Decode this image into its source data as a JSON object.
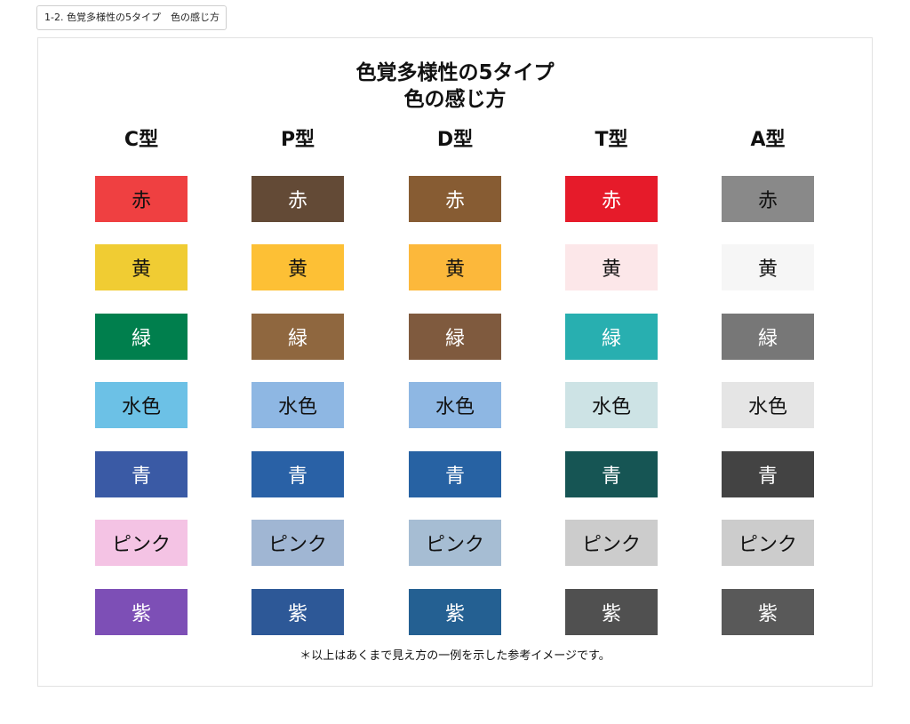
{
  "tab": {
    "label": "1-2. 色覚多様性の5タイプ　色の感じ方"
  },
  "title": {
    "line1": "色覚多様性の5タイプ",
    "line2": "色の感じ方"
  },
  "columns": [
    {
      "name": "C型",
      "swatches": [
        {
          "label": "赤",
          "bg": "#EF4041",
          "fg": "#111111"
        },
        {
          "label": "黄",
          "bg": "#F0CC33",
          "fg": "#111111"
        },
        {
          "label": "緑",
          "bg": "#007F4D",
          "fg": "#FFFFFF"
        },
        {
          "label": "水色",
          "bg": "#6CC1E6",
          "fg": "#111111"
        },
        {
          "label": "青",
          "bg": "#3A5AA5",
          "fg": "#FFFFFF"
        },
        {
          "label": "ピンク",
          "bg": "#F4C3E4",
          "fg": "#111111"
        },
        {
          "label": "紫",
          "bg": "#7D4FB6",
          "fg": "#FFFFFF"
        }
      ]
    },
    {
      "name": "P型",
      "swatches": [
        {
          "label": "赤",
          "bg": "#634A36",
          "fg": "#FFFFFF"
        },
        {
          "label": "黄",
          "bg": "#FDC035",
          "fg": "#111111"
        },
        {
          "label": "緑",
          "bg": "#8F673F",
          "fg": "#FFFFFF"
        },
        {
          "label": "水色",
          "bg": "#8EB7E3",
          "fg": "#111111"
        },
        {
          "label": "青",
          "bg": "#2961A6",
          "fg": "#FFFFFF"
        },
        {
          "label": "ピンク",
          "bg": "#A0B6D3",
          "fg": "#111111"
        },
        {
          "label": "紫",
          "bg": "#2D5897",
          "fg": "#FFFFFF"
        }
      ]
    },
    {
      "name": "D型",
      "swatches": [
        {
          "label": "赤",
          "bg": "#875C33",
          "fg": "#FFFFFF"
        },
        {
          "label": "黄",
          "bg": "#FCB83B",
          "fg": "#111111"
        },
        {
          "label": "緑",
          "bg": "#7F5A3E",
          "fg": "#FFFFFF"
        },
        {
          "label": "水色",
          "bg": "#8EB7E3",
          "fg": "#111111"
        },
        {
          "label": "青",
          "bg": "#2762A3",
          "fg": "#FFFFFF"
        },
        {
          "label": "ピンク",
          "bg": "#A6BDD3",
          "fg": "#111111"
        },
        {
          "label": "紫",
          "bg": "#246092",
          "fg": "#FFFFFF"
        }
      ]
    },
    {
      "name": "T型",
      "swatches": [
        {
          "label": "赤",
          "bg": "#E61B2A",
          "fg": "#FFFFFF"
        },
        {
          "label": "黄",
          "bg": "#FCE7E9",
          "fg": "#111111"
        },
        {
          "label": "緑",
          "bg": "#28AFB0",
          "fg": "#FFFFFF"
        },
        {
          "label": "水色",
          "bg": "#CDE3E5",
          "fg": "#111111"
        },
        {
          "label": "青",
          "bg": "#165554",
          "fg": "#FFFFFF"
        },
        {
          "label": "ピンク",
          "bg": "#CCCCCC",
          "fg": "#111111"
        },
        {
          "label": "紫",
          "bg": "#505050",
          "fg": "#FFFFFF"
        }
      ]
    },
    {
      "name": "A型",
      "swatches": [
        {
          "label": "赤",
          "bg": "#898989",
          "fg": "#111111"
        },
        {
          "label": "黄",
          "bg": "#F6F6F6",
          "fg": "#111111"
        },
        {
          "label": "緑",
          "bg": "#777777",
          "fg": "#FFFFFF"
        },
        {
          "label": "水色",
          "bg": "#E5E5E5",
          "fg": "#111111"
        },
        {
          "label": "青",
          "bg": "#434343",
          "fg": "#FFFFFF"
        },
        {
          "label": "ピンク",
          "bg": "#CCCCCC",
          "fg": "#111111"
        },
        {
          "label": "紫",
          "bg": "#595959",
          "fg": "#FFFFFF"
        }
      ]
    }
  ],
  "note": "＊以上はあくまで見え方の一例を示した参考イメージです。"
}
